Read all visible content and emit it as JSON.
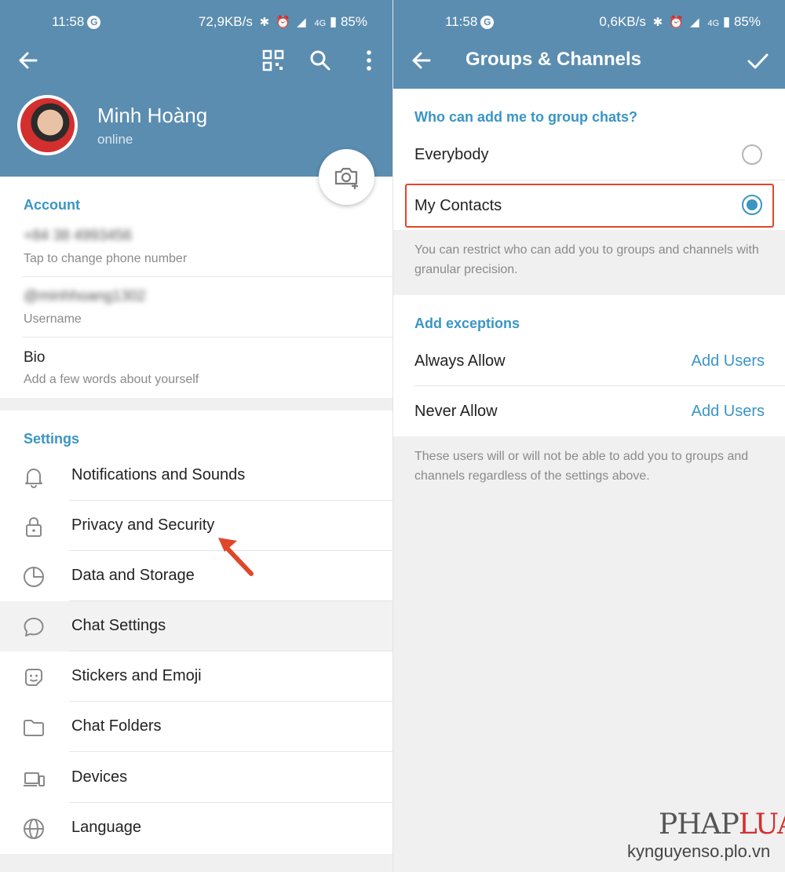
{
  "left": {
    "status": {
      "time": "11:58",
      "g_badge": "G",
      "speed": "72,9KB/s",
      "icons": "✱ ⏰ ◢",
      "network": "4G",
      "battery": "85%"
    },
    "header": {
      "icons": [
        "back-arrow-icon",
        "qr-code-icon",
        "search-icon",
        "more-vert-icon"
      ],
      "name": "Minh Hoàng",
      "status": "online",
      "camera_icon": "add-photo-icon"
    },
    "account": {
      "title": "Account",
      "phone_value": "+84 38 4993456",
      "phone_hint": "Tap to change phone number",
      "username_value": "@minhhoang1302",
      "username_hint": "Username",
      "bio_label": "Bio",
      "bio_hint": "Add a few words about yourself"
    },
    "settings": {
      "title": "Settings",
      "items": [
        {
          "label": "Notifications and Sounds",
          "icon": "bell-icon"
        },
        {
          "label": "Privacy and Security",
          "icon": "lock-icon"
        },
        {
          "label": "Data and Storage",
          "icon": "pie-chart-icon"
        },
        {
          "label": "Chat Settings",
          "icon": "chat-bubble-icon"
        },
        {
          "label": "Stickers and Emoji",
          "icon": "sticker-icon"
        },
        {
          "label": "Chat Folders",
          "icon": "folder-icon"
        },
        {
          "label": "Devices",
          "icon": "devices-icon"
        },
        {
          "label": "Language",
          "icon": "globe-icon"
        }
      ]
    }
  },
  "right": {
    "status": {
      "time": "11:58",
      "g_badge": "G",
      "speed": "0,6KB/s",
      "icons": "✱ ⏰ ◢",
      "network": "4G",
      "battery": "85%"
    },
    "header": {
      "title": "Groups & Channels",
      "icons": [
        "back-arrow-icon",
        "checkmark-icon"
      ]
    },
    "who_can_add": {
      "title": "Who can add me to group chats?",
      "options": [
        {
          "label": "Everybody",
          "selected": false
        },
        {
          "label": "My Contacts",
          "selected": true
        }
      ],
      "info": "You can restrict who can add you to groups and channels with granular precision."
    },
    "exceptions": {
      "title": "Add exceptions",
      "rows": [
        {
          "label": "Always Allow",
          "action": "Add Users"
        },
        {
          "label": "Never Allow",
          "action": "Add Users"
        }
      ],
      "info": "These users will or will not be able to add you to groups and channels regardless of the settings above."
    }
  },
  "watermark": {
    "brand_a": "PHAP",
    "brand_b": "LUAT",
    "site": "kynguyenso.plo.vn"
  },
  "colors": {
    "header": "#5b8db0",
    "accent": "#3a95c6",
    "highlight": "#e0462a"
  }
}
